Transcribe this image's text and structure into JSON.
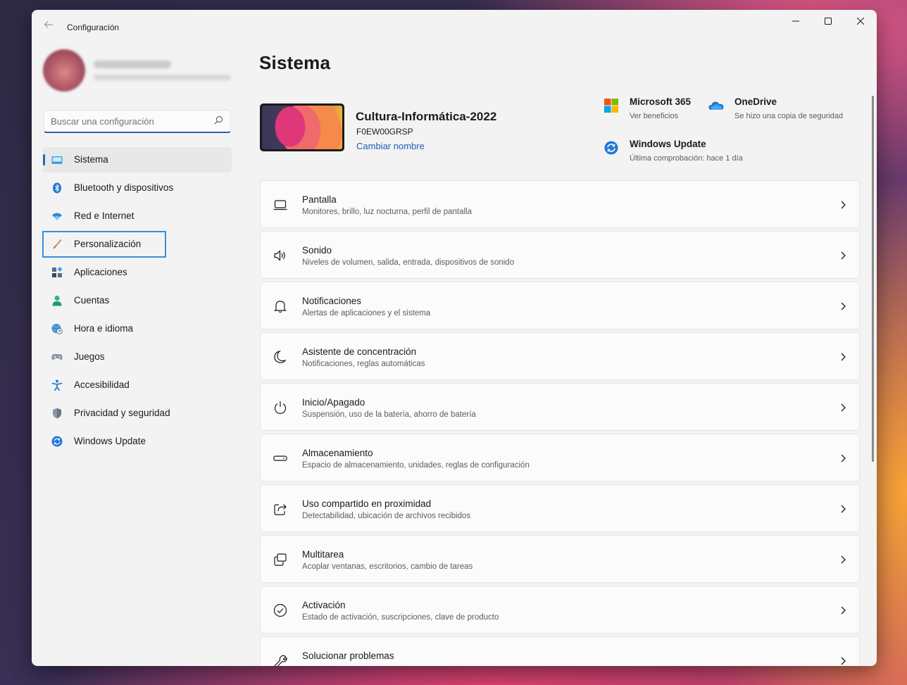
{
  "window": {
    "title": "Configuración"
  },
  "search": {
    "placeholder": "Buscar una configuración"
  },
  "sidebar": {
    "items": [
      {
        "label": "Sistema"
      },
      {
        "label": "Bluetooth y dispositivos"
      },
      {
        "label": "Red e Internet"
      },
      {
        "label": "Personalización"
      },
      {
        "label": "Aplicaciones"
      },
      {
        "label": "Cuentas"
      },
      {
        "label": "Hora e idioma"
      },
      {
        "label": "Juegos"
      },
      {
        "label": "Accesibilidad"
      },
      {
        "label": "Privacidad y seguridad"
      },
      {
        "label": "Windows Update"
      }
    ]
  },
  "main": {
    "title": "Sistema",
    "device": {
      "name": "Cultura-Informática-2022",
      "model": "F0EW00GRSP",
      "rename_label": "Cambiar nombre"
    },
    "quick_links": {
      "microsoft365": {
        "title": "Microsoft 365",
        "subtitle": "Ver beneficios"
      },
      "onedrive": {
        "title": "OneDrive",
        "subtitle": "Se hizo una copia de seguridad"
      },
      "windows_update": {
        "title": "Windows Update",
        "subtitle": "Última comprobación: hace 1 día"
      }
    },
    "cards": [
      {
        "title": "Pantalla",
        "subtitle": "Monitores, brillo, luz nocturna, perfil de pantalla"
      },
      {
        "title": "Sonido",
        "subtitle": "Niveles de volumen, salida, entrada, dispositivos de sonido"
      },
      {
        "title": "Notificaciones",
        "subtitle": "Alertas de aplicaciones y el sistema"
      },
      {
        "title": "Asistente de concentración",
        "subtitle": "Notificaciones, reglas automáticas"
      },
      {
        "title": "Inicio/Apagado",
        "subtitle": "Suspensión, uso de la batería, ahorro de batería"
      },
      {
        "title": "Almacenamiento",
        "subtitle": "Espacio de almacenamiento, unidades, reglas de configuración"
      },
      {
        "title": "Uso compartido en proximidad",
        "subtitle": "Detectabilidad, ubicación de archivos recibidos"
      },
      {
        "title": "Multitarea",
        "subtitle": "Acoplar ventanas, escritorios, cambio de tareas"
      },
      {
        "title": "Activación",
        "subtitle": "Estado de activación, suscripciones, clave de producto"
      },
      {
        "title": "Solucionar problemas",
        "subtitle": ""
      }
    ]
  },
  "colors": {
    "accent": "#2466c4",
    "link": "#1d5fb5",
    "window_bg": "#f3f3f3",
    "card_bg": "#fbfbfb"
  }
}
